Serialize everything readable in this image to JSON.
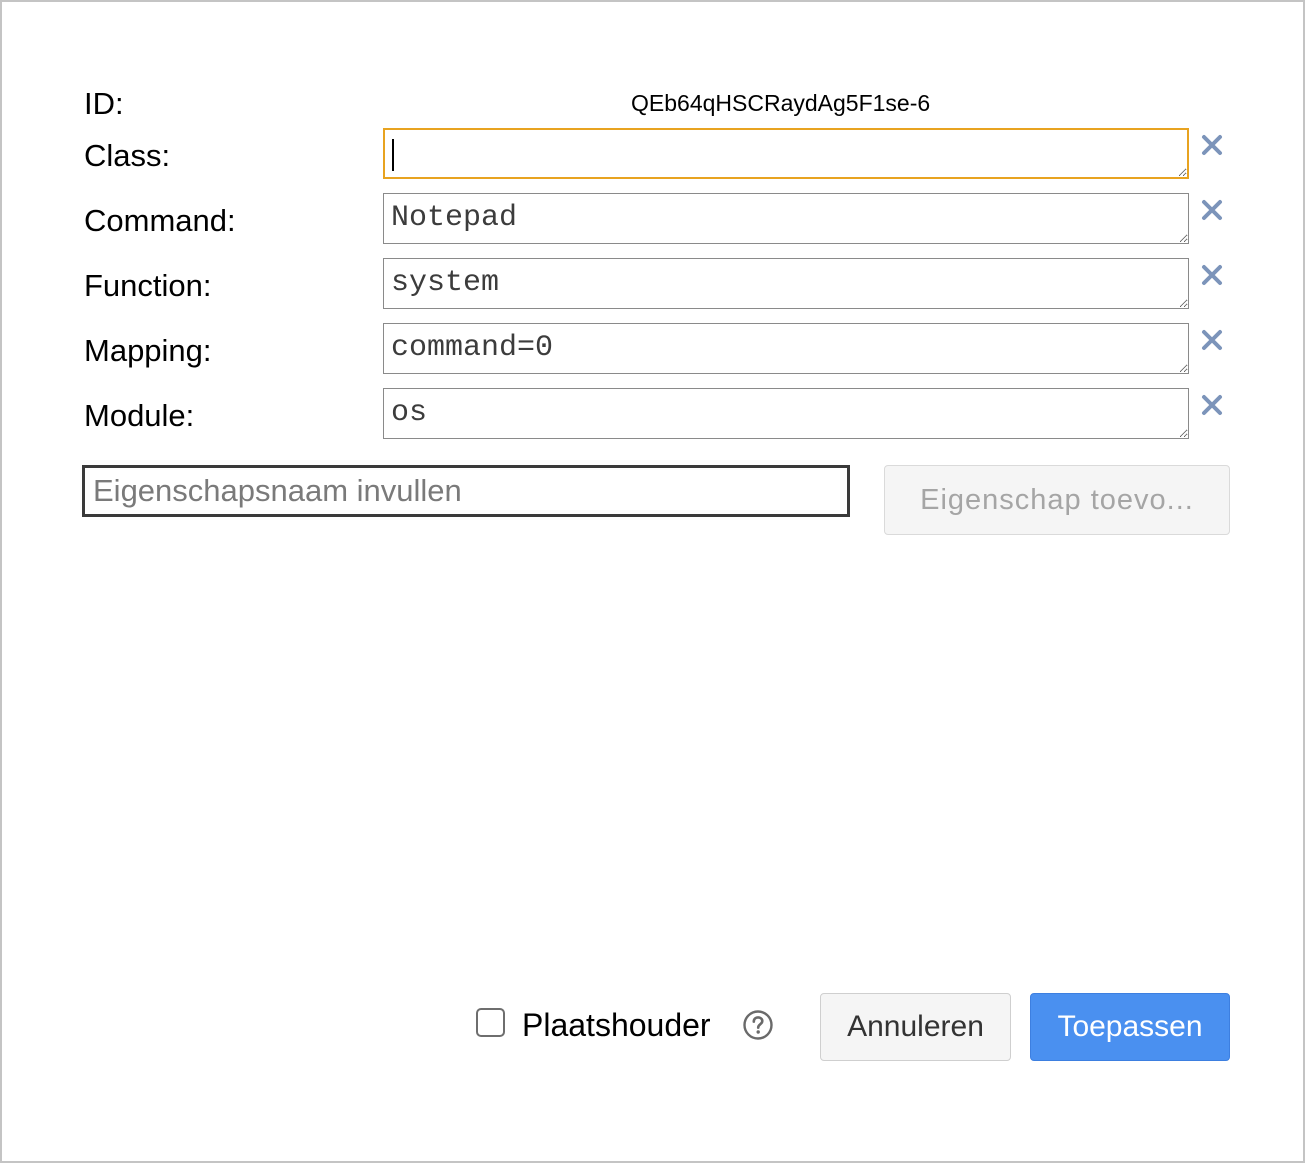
{
  "id_row": {
    "label": "ID:",
    "value": "QEb64qHSCRaydAg5F1se-6"
  },
  "properties": [
    {
      "label": "Class:",
      "value": ""
    },
    {
      "label": "Command:",
      "value": "Notepad"
    },
    {
      "label": "Function:",
      "value": "system"
    },
    {
      "label": "Mapping:",
      "value": "command=0"
    },
    {
      "label": "Module:",
      "value": "os"
    }
  ],
  "add_property": {
    "placeholder": "Eigenschapsnaam invullen",
    "button_label": "Eigenschap toevo..."
  },
  "footer": {
    "placeholder_label": "Plaatshouder",
    "placeholder_checked": false,
    "cancel_label": "Annuleren",
    "apply_label": "Toepassen"
  },
  "colors": {
    "focus_border": "#e8a320",
    "delete_icon": "#7c94ba",
    "apply_bg": "#4a90f0"
  },
  "icons": {
    "delete": "close-icon",
    "help": "help-circle-icon"
  }
}
